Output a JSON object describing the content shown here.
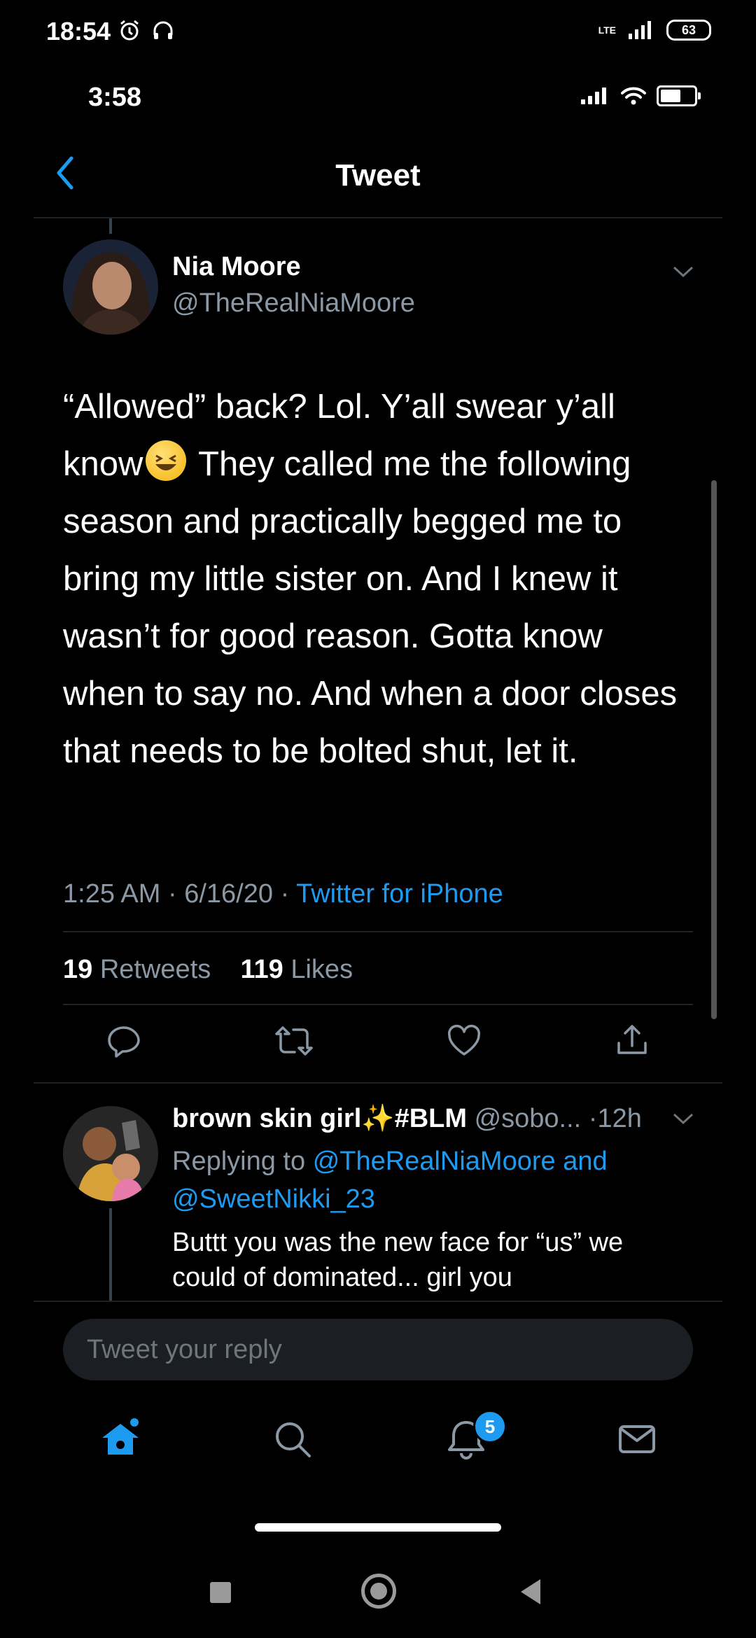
{
  "system_status": {
    "time": "18:54",
    "network": "LTE",
    "battery": "63"
  },
  "ios_status": {
    "time": "3:58"
  },
  "header": {
    "title": "Tweet"
  },
  "tweet": {
    "author_name": "Nia Moore",
    "author_handle": "@TheRealNiaMoore",
    "text_part1": "“Allowed” back? Lol. Y’all swear y’all know",
    "text_part2": " They called me the following season and practically begged me to bring my little sister on. And I knew it wasn’t for good reason. Gotta know when to say no. And when a door closes that needs to be bolted shut, let it.",
    "emoji": "laughing-face",
    "time": "1:25 AM",
    "date": "6/16/20",
    "source": "Twitter for iPhone",
    "retweet_count": "19",
    "retweet_label": "Retweets",
    "like_count": "119",
    "like_label": "Likes",
    "separator": "·"
  },
  "actions": [
    "reply-icon",
    "retweet-icon",
    "like-icon",
    "share-icon"
  ],
  "reply": {
    "author_name": "brown skin girl✨#BLM",
    "author_handle": "@sobo...",
    "age": "12h",
    "replying_prefix": "Replying to",
    "replying_to_1": "@TheRealNiaMoore",
    "replying_and": "and",
    "replying_to_2": "@SweetNikki_23",
    "text": "Buttt you was the new face for “us” we could of dominated... girl you"
  },
  "composer": {
    "placeholder": "Tweet your reply"
  },
  "tabbar": {
    "items": [
      "home-icon",
      "search-icon",
      "notifications-icon",
      "messages-icon"
    ],
    "notification_badge": "5"
  },
  "colors": {
    "accent": "#1d9bf0",
    "background": "#000000",
    "secondary_text": "#8b98a5"
  }
}
